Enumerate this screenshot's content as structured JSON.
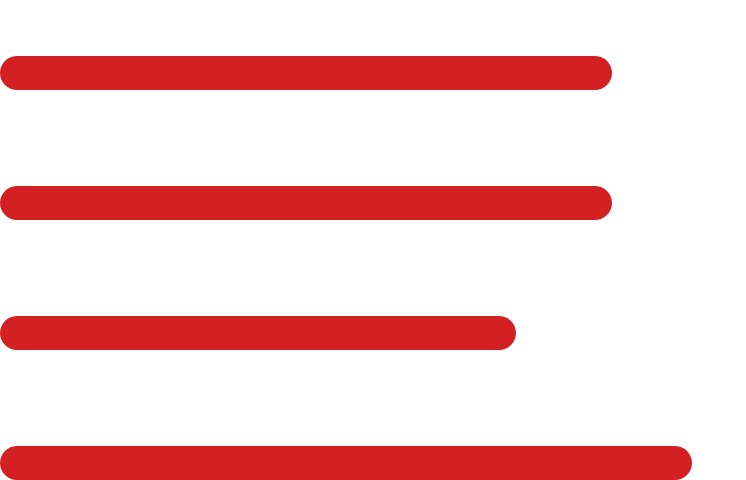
{
  "icon": "align-left-text-lines-icon",
  "colors": {
    "background": "#ffffff",
    "line": "#d32022"
  },
  "lines": [
    {
      "name": "line-1"
    },
    {
      "name": "line-2"
    },
    {
      "name": "line-3"
    },
    {
      "name": "line-4"
    }
  ]
}
